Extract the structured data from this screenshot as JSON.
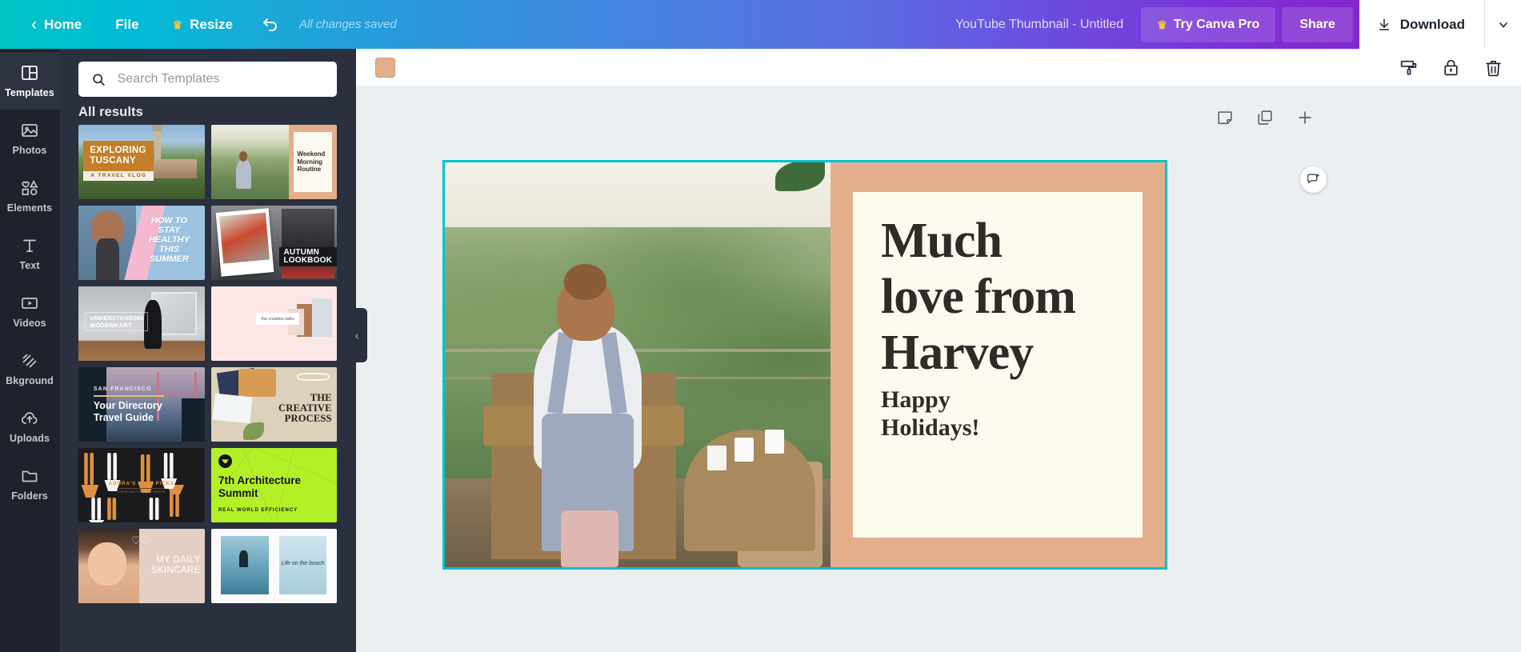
{
  "header": {
    "home_label": "Home",
    "file_label": "File",
    "resize_label": "Resize",
    "undo_icon": "undo-icon",
    "saved_status": "All changes saved",
    "document_title": "YouTube Thumbnail - Untitled",
    "pro_label": "Try Canva Pro",
    "share_label": "Share",
    "download_label": "Download",
    "download_caret": "⌄",
    "colors": {
      "gradient_start": "#00c4c4",
      "gradient_mid": "#4a7fe0",
      "gradient_end": "#8b1fc4",
      "crown": "#f5c542"
    }
  },
  "sidebar": {
    "items": [
      {
        "label": "Templates",
        "icon": "templates-icon",
        "active": true
      },
      {
        "label": "Photos",
        "icon": "photos-icon",
        "active": false
      },
      {
        "label": "Elements",
        "icon": "elements-icon",
        "active": false
      },
      {
        "label": "Text",
        "icon": "text-icon",
        "active": false
      },
      {
        "label": "Videos",
        "icon": "videos-icon",
        "active": false
      },
      {
        "label": "Bkground",
        "icon": "background-icon",
        "active": false
      },
      {
        "label": "Uploads",
        "icon": "uploads-icon",
        "active": false
      },
      {
        "label": "Folders",
        "icon": "folders-icon",
        "active": false
      }
    ]
  },
  "panel": {
    "search": {
      "placeholder": "Search Templates",
      "value": "",
      "icon": "search-icon"
    },
    "heading": "All results",
    "collapse_icon": "‹",
    "templates": [
      {
        "id": "t1",
        "name": "exploring-tuscany",
        "title": "EXPLORING\nTUSCANY",
        "line1": "EXPLORING",
        "line2": "TUSCANY",
        "sub": "A TRAVEL VLOG"
      },
      {
        "id": "t2",
        "name": "weekend-morning",
        "title": "Weekend Morning Routine",
        "line1": "Weekend",
        "line2": "Morning",
        "line3": "Routine"
      },
      {
        "id": "t3",
        "name": "stay-healthy-summer",
        "title": "HOW TO STAY HEALTHY THIS SUMMER",
        "line1": "HOW TO",
        "line2": "STAY",
        "line3": "HEALTHY",
        "line4": "THIS",
        "line5": "SUMMER"
      },
      {
        "id": "t4",
        "name": "autumn-lookbook",
        "title": "AUTUMN LOOKBOOK",
        "line1": "AUTUMN",
        "line2": "LOOKBOOK"
      },
      {
        "id": "t5",
        "name": "understanding-modern-art",
        "title": "UNDERSTANDING MODERN ART",
        "line1": "UNDERSTANDING",
        "line2": "MODERN ART"
      },
      {
        "id": "t6",
        "name": "pink-moodboard",
        "title": "the creative talks",
        "line1": "the creative talks"
      },
      {
        "id": "t7",
        "name": "sf-travel-guide",
        "title": "Your Directory Travel Guide",
        "kicker": "SAN FRANCISCO",
        "line1": "Your Directory",
        "line2": "Travel Guide"
      },
      {
        "id": "t8",
        "name": "creative-process",
        "title": "THE CREATIVE PROCESS",
        "line1": "THE",
        "line2": "CREATIVE",
        "line3": "PROCESS"
      },
      {
        "id": "t9",
        "name": "adoras-jazz-picks",
        "title": "ADORA'S JAZZ PICKS",
        "line1": "ADORA'S JAZZ PICKS",
        "sub": "A PLAYLIST FOR LATE NIGHTS"
      },
      {
        "id": "t10",
        "name": "architecture-summit",
        "title": "7th Architecture Summit",
        "line1": "7th Architecture",
        "line2": "Summit",
        "sub": "REAL WORLD EFFICIENCY"
      },
      {
        "id": "t11",
        "name": "my-daily-skincare",
        "title": "MY DAILY SKINCARE",
        "line1": "MY DAILY",
        "line2": "SKINCARE"
      },
      {
        "id": "t12",
        "name": "life-on-the-beach",
        "title": "Life on the beach",
        "line1": "Life on",
        "line2": "the beach"
      }
    ]
  },
  "editor": {
    "context_bar": {
      "color_swatch": "#e3ae8b",
      "color_swatch_name": "color-swatch",
      "icons": [
        {
          "name": "copy-style-icon",
          "label": "Copy style"
        },
        {
          "name": "lock-icon",
          "label": "Lock"
        },
        {
          "name": "delete-icon",
          "label": "Delete"
        }
      ]
    },
    "page_tools": [
      {
        "name": "add-note-icon",
        "label": "Add note"
      },
      {
        "name": "duplicate-page-icon",
        "label": "Duplicate page"
      },
      {
        "name": "add-page-icon",
        "label": "Add page"
      }
    ],
    "comment_button": {
      "name": "add-comment-icon",
      "label": "Add comment"
    },
    "design": {
      "selection_color": "#00c4cc",
      "background_color": "#e3ae8b",
      "card_color": "#fdfbf0",
      "headline": "Much\nlove from\nHarvey",
      "headline_lines": [
        "Much",
        "love from",
        "Harvey"
      ],
      "subhead": "Happy\nHolidays!",
      "subhead_lines": [
        "Happy",
        "Holidays!"
      ],
      "text_color": "#2e2b28"
    }
  }
}
